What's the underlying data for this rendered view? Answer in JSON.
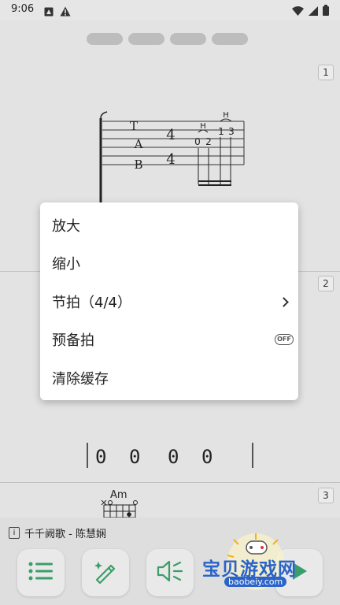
{
  "status_bar": {
    "time": "9:06"
  },
  "score": {
    "page_numbers": [
      "1",
      "2",
      "3"
    ],
    "tab_letters": [
      "T",
      "A",
      "B"
    ],
    "time_signature": [
      "4",
      "4"
    ],
    "hammer_labels": [
      "H",
      "H"
    ],
    "fret_numbers": [
      "0",
      "2",
      "1",
      "3"
    ],
    "beat_digits": [
      "0",
      "0",
      "0",
      "0"
    ],
    "chord_name": "Am"
  },
  "menu": {
    "items": [
      {
        "label": "放大"
      },
      {
        "label": "缩小"
      },
      {
        "label": "节拍（4/4）"
      },
      {
        "label": "预备拍"
      },
      {
        "label": "清除缓存"
      }
    ],
    "toggle_text": "OFF"
  },
  "now_playing": {
    "title": "千千阙歌 - 陈慧娴",
    "info_glyph": "i"
  },
  "toolbar": {
    "buttons": [
      {
        "icon": "list-icon"
      },
      {
        "icon": "magic-pen-icon"
      },
      {
        "icon": "volume-icon"
      },
      {
        "icon": "play-icon"
      }
    ]
  },
  "watermark": {
    "brand": "宝贝游戏网",
    "url": "baobeiy.com"
  },
  "colors": {
    "accent_green": "#3a9e6a",
    "watermark_blue": "#2a63c9"
  }
}
